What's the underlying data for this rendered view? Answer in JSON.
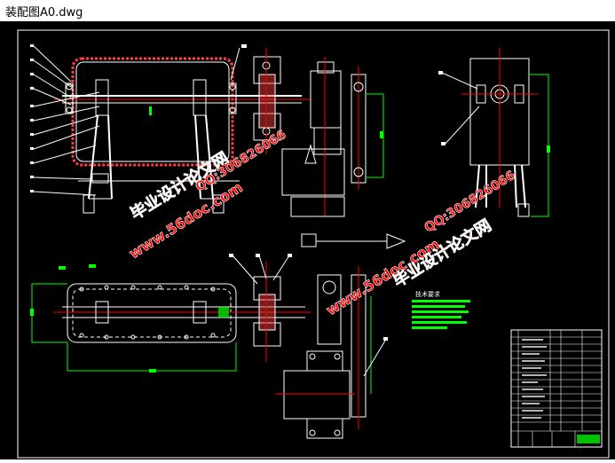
{
  "window": {
    "title": "装配图A0.dwg"
  },
  "colors": {
    "background": "#000000",
    "frame": "#ffffff",
    "main_lines": "#ffffff",
    "dimension": "#00ff00",
    "centerline": "#ff0000",
    "housing": "#ff4040",
    "watermark": "#ff0000"
  },
  "watermarks": [
    "www.56doc.com",
    "毕业设计论文网",
    "QQ:306826066"
  ],
  "notes_header": "技术要求",
  "icons": [
    "arrow-right-icon",
    "arrow-up-icon"
  ]
}
